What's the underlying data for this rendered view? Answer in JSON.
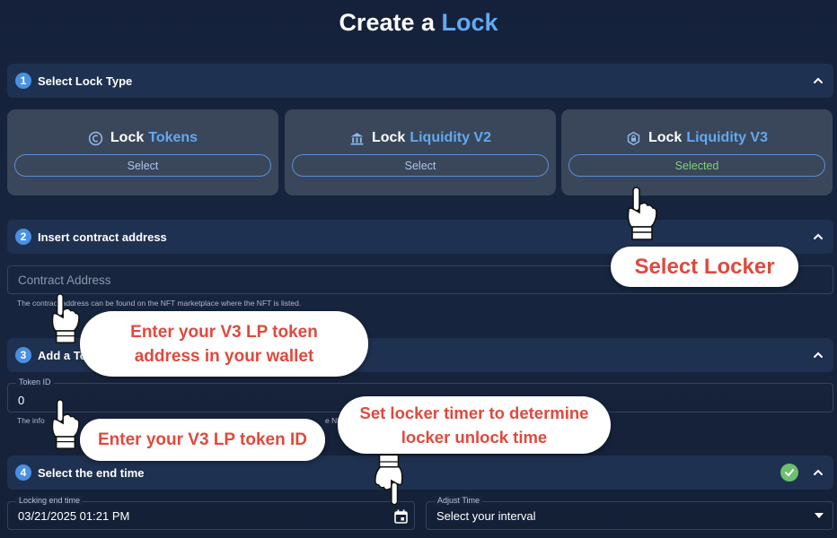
{
  "page_title": {
    "prefix": "Create a",
    "accent": "Lock"
  },
  "sections": {
    "s1": {
      "number": "1",
      "title": "Select Lock Type"
    },
    "s2": {
      "number": "2",
      "title": "Insert contract address"
    },
    "s3": {
      "number": "3",
      "title": "Add a To"
    },
    "s4": {
      "number": "4",
      "title": "Select the end time"
    }
  },
  "lock_cards": [
    {
      "prefix": "Lock",
      "accent": "Tokens",
      "button": "Select",
      "icon": "token-coin-icon"
    },
    {
      "prefix": "Lock",
      "accent": "Liquidity V2",
      "button": "Select",
      "icon": "bank-icon"
    },
    {
      "prefix": "Lock",
      "accent": "Liquidity V3",
      "button": "Selected",
      "icon": "hexagon-lock-icon"
    }
  ],
  "contract": {
    "placeholder": "Contract Address",
    "helper_visible_left": "The cont",
    "helper_visible_right": "ract address can be found on the NFT marketplace where the NFT is listed."
  },
  "token": {
    "label": "Token ID",
    "value": "0",
    "helper_left": "The info",
    "helper_right": "e NFT"
  },
  "end_time": {
    "locking_label": "Locking end time",
    "locking_value": "03/21/2025 01:21 PM",
    "adjust_label": "Adjust Time",
    "adjust_value": "Select your interval"
  },
  "annotations": {
    "select_locker": "Select Locker",
    "enter_address_line1": "Enter your V3 LP token",
    "enter_address_line2": "address in your wallet",
    "enter_id": "Enter your V3 LP token ID",
    "set_timer_line1": "Set locker timer to determine",
    "set_timer_line2": "locker unlock time"
  },
  "colors": {
    "accent": "#62a9f2",
    "step_badge": "#4a90e2",
    "selected_text": "#7fd27f",
    "annotation_text": "#e0493d",
    "check": "#6cc070"
  }
}
